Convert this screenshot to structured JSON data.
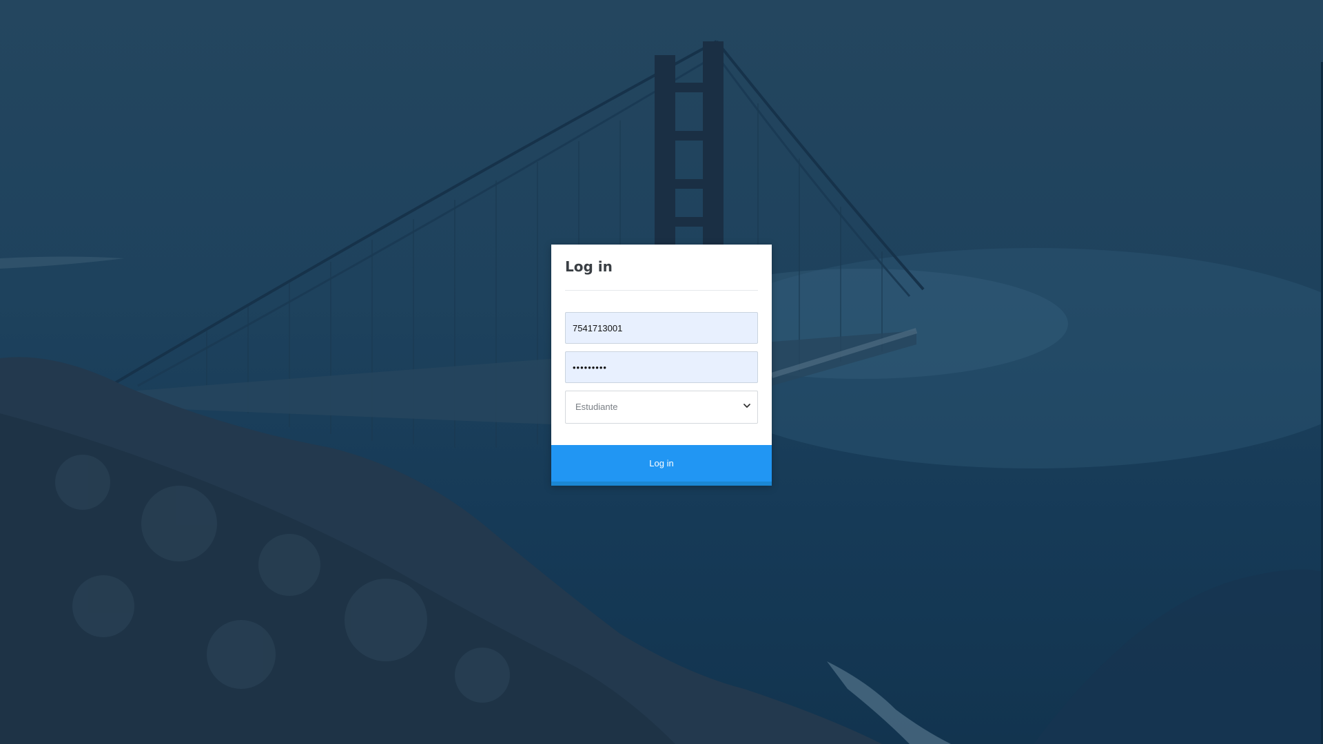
{
  "page": {
    "background_image": "fog-covered suspension bridge over hills, blue tinted",
    "accent_color": "#2196f3"
  },
  "login": {
    "title": "Log in",
    "username_value": "7541713001",
    "password_value": "•••••••••",
    "role_select": {
      "selected": "Estudiante",
      "icon": "chevron-down-icon"
    },
    "submit_label": "Log in"
  }
}
